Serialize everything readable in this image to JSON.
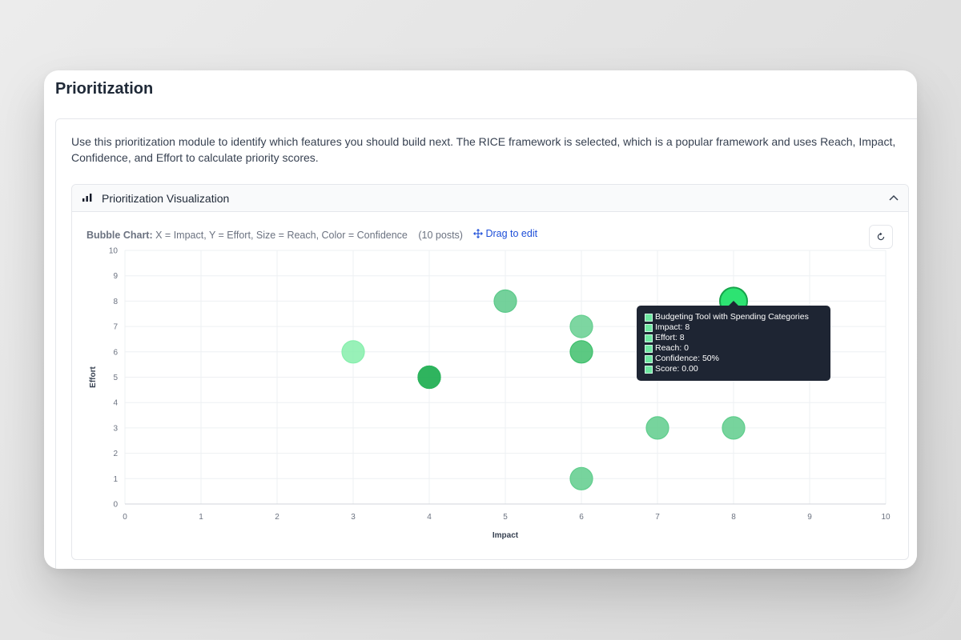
{
  "page": {
    "title": "Prioritization"
  },
  "description": "Use this prioritization module to identify which features you should build next. The RICE framework is selected, which is a popular framework and uses Reach, Impact, Confidence, and Effort to calculate priority scores.",
  "panel": {
    "title": "Prioritization Visualization",
    "icon": "bar-chart-icon",
    "collapse_icon": "chevron-up-icon"
  },
  "caption": {
    "lead": "Bubble Chart:",
    "mapping": "X = Impact, Y = Effort, Size = Reach, Color = Confidence",
    "count": "(10 posts)",
    "drag_label": "Drag to edit",
    "drag_icon": "move-icon",
    "reset_icon": "refresh-icon"
  },
  "tooltip": {
    "title": "Budgeting Tool with Spending Categories",
    "lines": [
      "Impact: 8",
      "Effort: 8",
      "Reach: 0",
      "Confidence: 50%",
      "Score: 0.00"
    ]
  },
  "colors": {
    "accent_link": "#1d4ed8",
    "bubble_light": "#86efac",
    "bubble_mid": "#4ade80",
    "bubble_dark": "#22c55e",
    "highlight": "#22e26a"
  },
  "chart_data": {
    "type": "scatter",
    "xlabel": "Impact",
    "ylabel": "Effort",
    "xlim": [
      0,
      10
    ],
    "ylim": [
      0,
      10
    ],
    "xticks": [
      0,
      1,
      2,
      3,
      4,
      5,
      6,
      7,
      8,
      9,
      10
    ],
    "yticks": [
      0,
      1,
      2,
      3,
      4,
      5,
      6,
      7,
      8,
      9,
      10
    ],
    "grid": true,
    "points": [
      {
        "x": 3,
        "y": 6,
        "color": "#86efac"
      },
      {
        "x": 4,
        "y": 5,
        "color": "#22a552"
      },
      {
        "x": 4,
        "y": 5,
        "color": "#2bb45c"
      },
      {
        "x": 5,
        "y": 8,
        "color": "#5cc98a"
      },
      {
        "x": 6,
        "y": 7,
        "color": "#66cf90"
      },
      {
        "x": 6,
        "y": 6,
        "color": "#3fbf6c"
      },
      {
        "x": 6,
        "y": 1,
        "color": "#5fcd8c"
      },
      {
        "x": 7,
        "y": 3,
        "color": "#5fcd8c"
      },
      {
        "x": 8,
        "y": 3,
        "color": "#5fcd8c"
      },
      {
        "x": 8,
        "y": 8,
        "color": "#22e26a",
        "highlighted": true
      }
    ]
  }
}
